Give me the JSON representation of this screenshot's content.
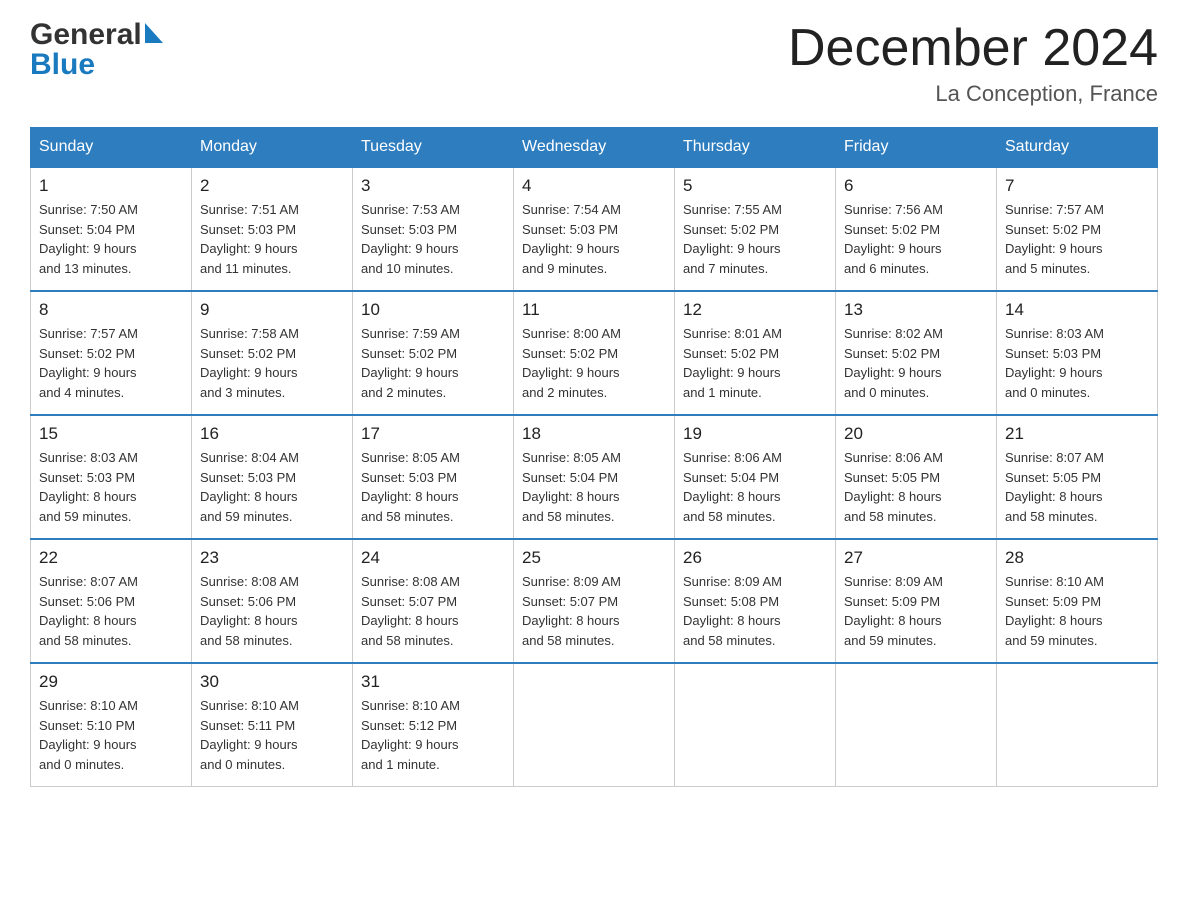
{
  "header": {
    "logo_line1": "General",
    "logo_line2": "Blue",
    "month_title": "December 2024",
    "location": "La Conception, France"
  },
  "days_of_week": [
    "Sunday",
    "Monday",
    "Tuesday",
    "Wednesday",
    "Thursday",
    "Friday",
    "Saturday"
  ],
  "weeks": [
    [
      {
        "day": "1",
        "sunrise": "7:50 AM",
        "sunset": "5:04 PM",
        "daylight": "9 hours and 13 minutes."
      },
      {
        "day": "2",
        "sunrise": "7:51 AM",
        "sunset": "5:03 PM",
        "daylight": "9 hours and 11 minutes."
      },
      {
        "day": "3",
        "sunrise": "7:53 AM",
        "sunset": "5:03 PM",
        "daylight": "9 hours and 10 minutes."
      },
      {
        "day": "4",
        "sunrise": "7:54 AM",
        "sunset": "5:03 PM",
        "daylight": "9 hours and 9 minutes."
      },
      {
        "day": "5",
        "sunrise": "7:55 AM",
        "sunset": "5:02 PM",
        "daylight": "9 hours and 7 minutes."
      },
      {
        "day": "6",
        "sunrise": "7:56 AM",
        "sunset": "5:02 PM",
        "daylight": "9 hours and 6 minutes."
      },
      {
        "day": "7",
        "sunrise": "7:57 AM",
        "sunset": "5:02 PM",
        "daylight": "9 hours and 5 minutes."
      }
    ],
    [
      {
        "day": "8",
        "sunrise": "7:57 AM",
        "sunset": "5:02 PM",
        "daylight": "9 hours and 4 minutes."
      },
      {
        "day": "9",
        "sunrise": "7:58 AM",
        "sunset": "5:02 PM",
        "daylight": "9 hours and 3 minutes."
      },
      {
        "day": "10",
        "sunrise": "7:59 AM",
        "sunset": "5:02 PM",
        "daylight": "9 hours and 2 minutes."
      },
      {
        "day": "11",
        "sunrise": "8:00 AM",
        "sunset": "5:02 PM",
        "daylight": "9 hours and 2 minutes."
      },
      {
        "day": "12",
        "sunrise": "8:01 AM",
        "sunset": "5:02 PM",
        "daylight": "9 hours and 1 minute."
      },
      {
        "day": "13",
        "sunrise": "8:02 AM",
        "sunset": "5:02 PM",
        "daylight": "9 hours and 0 minutes."
      },
      {
        "day": "14",
        "sunrise": "8:03 AM",
        "sunset": "5:03 PM",
        "daylight": "9 hours and 0 minutes."
      }
    ],
    [
      {
        "day": "15",
        "sunrise": "8:03 AM",
        "sunset": "5:03 PM",
        "daylight": "8 hours and 59 minutes."
      },
      {
        "day": "16",
        "sunrise": "8:04 AM",
        "sunset": "5:03 PM",
        "daylight": "8 hours and 59 minutes."
      },
      {
        "day": "17",
        "sunrise": "8:05 AM",
        "sunset": "5:03 PM",
        "daylight": "8 hours and 58 minutes."
      },
      {
        "day": "18",
        "sunrise": "8:05 AM",
        "sunset": "5:04 PM",
        "daylight": "8 hours and 58 minutes."
      },
      {
        "day": "19",
        "sunrise": "8:06 AM",
        "sunset": "5:04 PM",
        "daylight": "8 hours and 58 minutes."
      },
      {
        "day": "20",
        "sunrise": "8:06 AM",
        "sunset": "5:05 PM",
        "daylight": "8 hours and 58 minutes."
      },
      {
        "day": "21",
        "sunrise": "8:07 AM",
        "sunset": "5:05 PM",
        "daylight": "8 hours and 58 minutes."
      }
    ],
    [
      {
        "day": "22",
        "sunrise": "8:07 AM",
        "sunset": "5:06 PM",
        "daylight": "8 hours and 58 minutes."
      },
      {
        "day": "23",
        "sunrise": "8:08 AM",
        "sunset": "5:06 PM",
        "daylight": "8 hours and 58 minutes."
      },
      {
        "day": "24",
        "sunrise": "8:08 AM",
        "sunset": "5:07 PM",
        "daylight": "8 hours and 58 minutes."
      },
      {
        "day": "25",
        "sunrise": "8:09 AM",
        "sunset": "5:07 PM",
        "daylight": "8 hours and 58 minutes."
      },
      {
        "day": "26",
        "sunrise": "8:09 AM",
        "sunset": "5:08 PM",
        "daylight": "8 hours and 58 minutes."
      },
      {
        "day": "27",
        "sunrise": "8:09 AM",
        "sunset": "5:09 PM",
        "daylight": "8 hours and 59 minutes."
      },
      {
        "day": "28",
        "sunrise": "8:10 AM",
        "sunset": "5:09 PM",
        "daylight": "8 hours and 59 minutes."
      }
    ],
    [
      {
        "day": "29",
        "sunrise": "8:10 AM",
        "sunset": "5:10 PM",
        "daylight": "9 hours and 0 minutes."
      },
      {
        "day": "30",
        "sunrise": "8:10 AM",
        "sunset": "5:11 PM",
        "daylight": "9 hours and 0 minutes."
      },
      {
        "day": "31",
        "sunrise": "8:10 AM",
        "sunset": "5:12 PM",
        "daylight": "9 hours and 1 minute."
      },
      null,
      null,
      null,
      null
    ]
  ],
  "labels": {
    "sunrise": "Sunrise:",
    "sunset": "Sunset:",
    "daylight": "Daylight:"
  }
}
